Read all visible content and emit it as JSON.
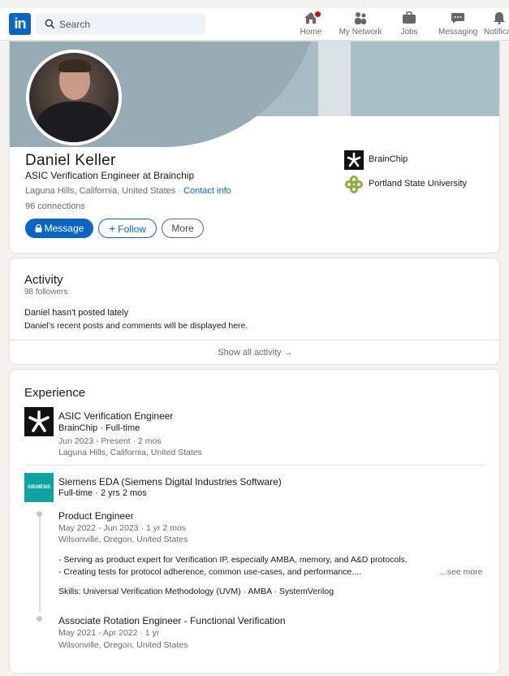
{
  "nav": {
    "logo": "in",
    "search_placeholder": "Search",
    "items": [
      {
        "label": "Home",
        "icon": "home-icon"
      },
      {
        "label": "My Network",
        "icon": "network-icon"
      },
      {
        "label": "Jobs",
        "icon": "briefcase-icon"
      },
      {
        "label": "Messaging",
        "icon": "messaging-icon"
      },
      {
        "label": "Notifica",
        "icon": "bell-icon"
      }
    ]
  },
  "profile": {
    "name": "Daniel Keller",
    "headline": "ASIC Verification Engineer at Brainchip",
    "location": "Laguna Hills, California, United States",
    "separator": " · ",
    "contact_info": "Contact info",
    "connections": "96 connections",
    "buttons": {
      "message": "Message",
      "follow": "Follow",
      "more": "More"
    },
    "current_company": "BrainChip",
    "education": "Portland State University"
  },
  "activity": {
    "title": "Activity",
    "followers": "98 followers",
    "empty_title": "Daniel hasn't posted lately",
    "empty_sub": "Daniel’s recent posts and comments will be displayed here.",
    "show_all": "Show all activity →"
  },
  "experience": {
    "title": "Experience",
    "job1": {
      "title": "ASIC Verification Engineer",
      "company": "BrainChip · Full-time",
      "dates": "Jun 2023 - Present · 2 mos",
      "location": "Laguna Hills, California, United States"
    },
    "company2": {
      "name": "Siemens EDA (Siemens Digital Industries Software)",
      "logo_text": "SIEMENS",
      "tenure": "Full-time · 2 yrs 2 mos",
      "role1": {
        "title": "Product Engineer",
        "dates": "May 2022 - Jun 2023 · 1 yr 2 mos",
        "location": "Wilsonville, Oregon, United States",
        "desc1": "- Serving as product expert for Verification IP, especially AMBA, memory, and A&D protocols.",
        "desc2": "- Creating tests for protocol adherence, common use-cases, and performance....",
        "see_more": "...see more",
        "skills": "Skills: Universal Verification Methodology (UVM) · AMBA · SystemVerilog"
      },
      "role2": {
        "title": "Associate Rotation Engineer - Functional Verification",
        "dates": "May 2021 - Apr 2022 · 1 yr",
        "location": "Wilsonville, Oregon, United States"
      }
    }
  },
  "colors": {
    "brand": "#0a66c2",
    "badge": "#cc1016",
    "siemens": "#0fa3a3"
  }
}
